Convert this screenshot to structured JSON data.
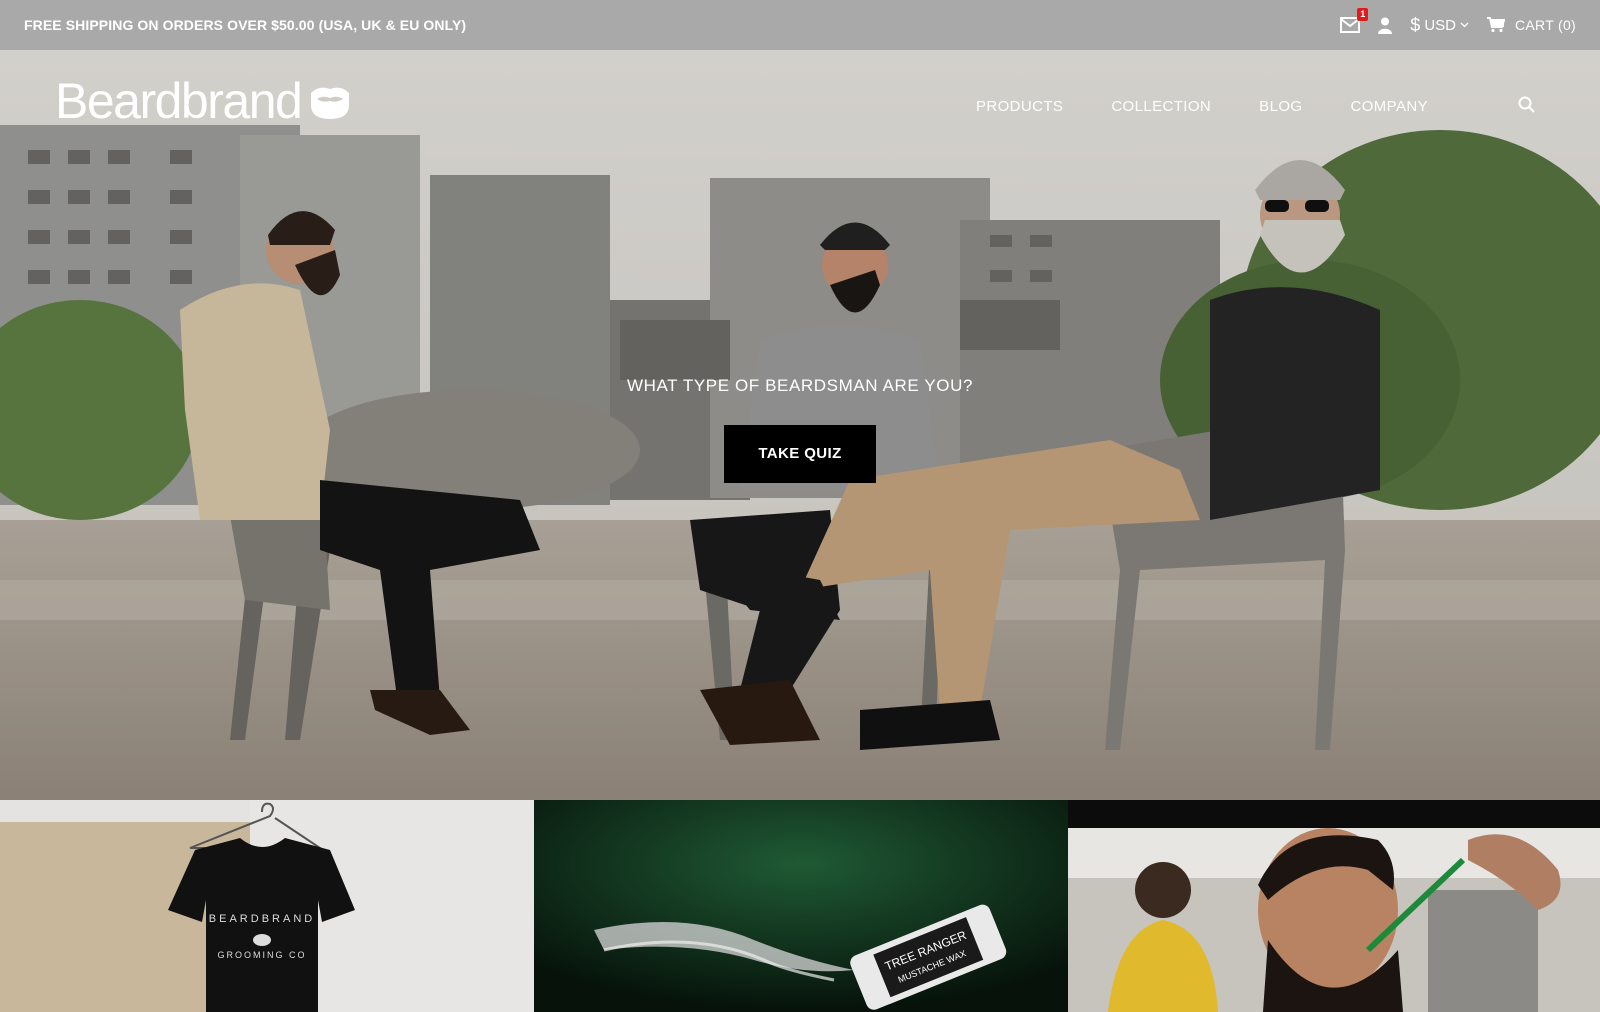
{
  "announcement": {
    "text": "FREE SHIPPING ON ORDERS OVER $50.00 (USA, UK & EU ONLY)"
  },
  "utility": {
    "mail_badge": "1",
    "currency_symbol": "$",
    "currency_code": "USD",
    "cart_label": "CART (0)"
  },
  "header": {
    "logo_text": "Beardbrand",
    "nav": [
      {
        "label": "PRODUCTS"
      },
      {
        "label": "COLLECTION"
      },
      {
        "label": "BLOG"
      },
      {
        "label": "COMPANY"
      }
    ]
  },
  "hero": {
    "question": "WHAT TYPE OF BEARDSMAN ARE YOU?",
    "button_label": "TAKE QUIZ"
  },
  "tiles": {
    "shirt_print_line1": "BEARDBRAND",
    "shirt_print_line2": "GROOMING CO",
    "product_line1": "TREE RANGER",
    "product_line2": "MUSTACHE WAX"
  },
  "colors": {
    "topbar_bg": "#a9a9a9",
    "button_bg": "#000000",
    "badge": "#e01b1b",
    "text": "#ffffff"
  },
  "icons": [
    "mail-icon",
    "user-icon",
    "chevron-down-icon",
    "cart-icon",
    "search-icon",
    "mustache-logo-icon"
  ]
}
